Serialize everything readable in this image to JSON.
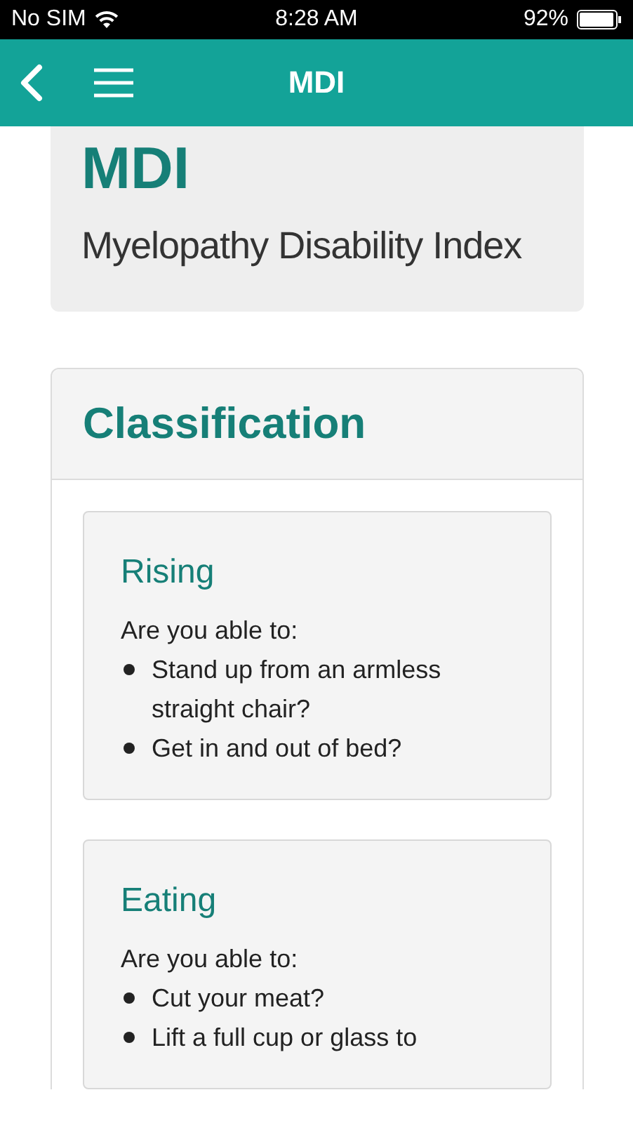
{
  "status_bar": {
    "carrier": "No SIM",
    "time": "8:28 AM",
    "battery": "92%"
  },
  "nav_bar": {
    "title": "MDI"
  },
  "header": {
    "title": "MDI",
    "subtitle": "Myelopathy Disability Index"
  },
  "section": {
    "title": "Classification",
    "cards": [
      {
        "title": "Rising",
        "prompt": "Are you able to:",
        "items": [
          "Stand up from an armless straight chair?",
          "Get in and out of bed?"
        ]
      },
      {
        "title": "Eating",
        "prompt": "Are you able to:",
        "items": [
          "Cut your meat?",
          "Lift a full cup or glass to"
        ]
      }
    ]
  }
}
